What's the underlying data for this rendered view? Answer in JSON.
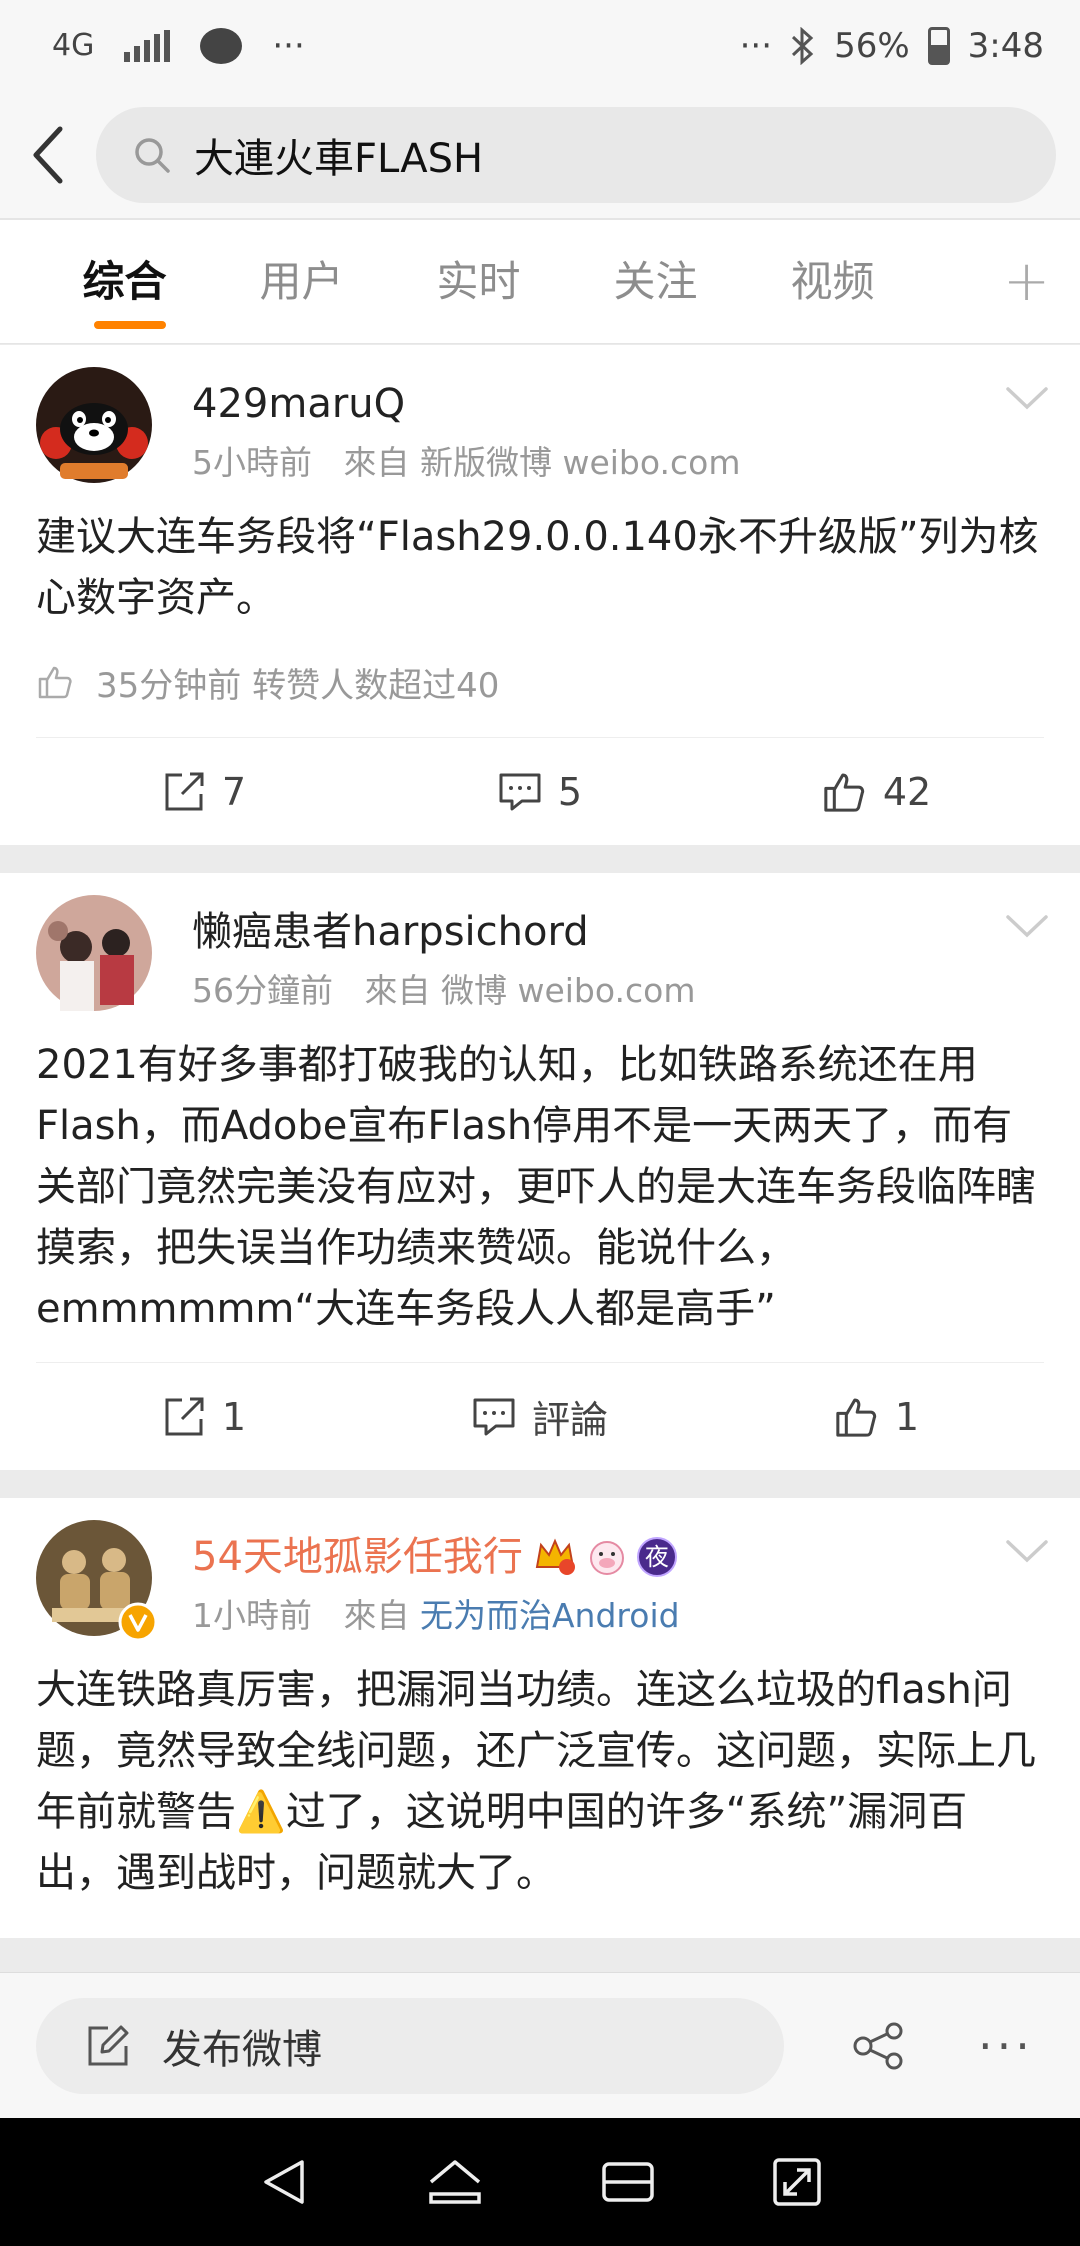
{
  "status_bar": {
    "network": "4G",
    "dots_left": "···",
    "dots_right": "···",
    "battery": "56%",
    "time": "3:48"
  },
  "search": {
    "value": "大連火車FLASH"
  },
  "tabs": [
    {
      "label": "综合",
      "active": true
    },
    {
      "label": "用户",
      "active": false
    },
    {
      "label": "实时",
      "active": false
    },
    {
      "label": "关注",
      "active": false
    },
    {
      "label": "视频",
      "active": false
    }
  ],
  "tab_plus": "+",
  "posts": [
    {
      "username": "429maruQ",
      "time": "5小時前",
      "from_label": "來自",
      "source": "新版微博 weibo.com",
      "text": "建议大连车务段将“Flash29.0.0.140永不升级版”列为核心数字资产。",
      "liked_info": "35分钟前 转赞人数超过40",
      "reposts": "7",
      "comments": "5",
      "likes": "42"
    },
    {
      "username": "懒癌患者harpsichord",
      "time": "56分鐘前",
      "from_label": "來自",
      "source": "微博 weibo.com",
      "text": "2021有好多事都打破我的认知，比如铁路系统还在用Flash，而Adobe宣布Flash停用不是一天两天了，而有关部门竟然完美没有应对，更吓人的是大连车务段临阵瞎摸索，把失误当作功绩来赞颂。能说什么，emmmmmm“大连车务段人人都是高手”",
      "reposts": "1",
      "comments": "評論",
      "likes": "1"
    },
    {
      "username": "54天地孤影任我行",
      "badge_night": "夜",
      "time": "1小時前",
      "from_label": "來自",
      "source": "无为而治Android",
      "text_part1": "大连铁路真厉害，把漏洞当功绩。连这么垃圾的flash问题，竟然导致全线问题，还广泛宣传。这问题，实际上几年前就警告",
      "warning_glyph": "⚠️",
      "text_part2": "过了，这说明中国的许多“系统”漏洞百出，遇到战时，问题就大了。"
    }
  ],
  "composer": {
    "label": "发布微博",
    "more": "···"
  },
  "colors": {
    "accent": "#ff8200",
    "vip_name": "#eb7350",
    "link": "#4a7cb0"
  }
}
